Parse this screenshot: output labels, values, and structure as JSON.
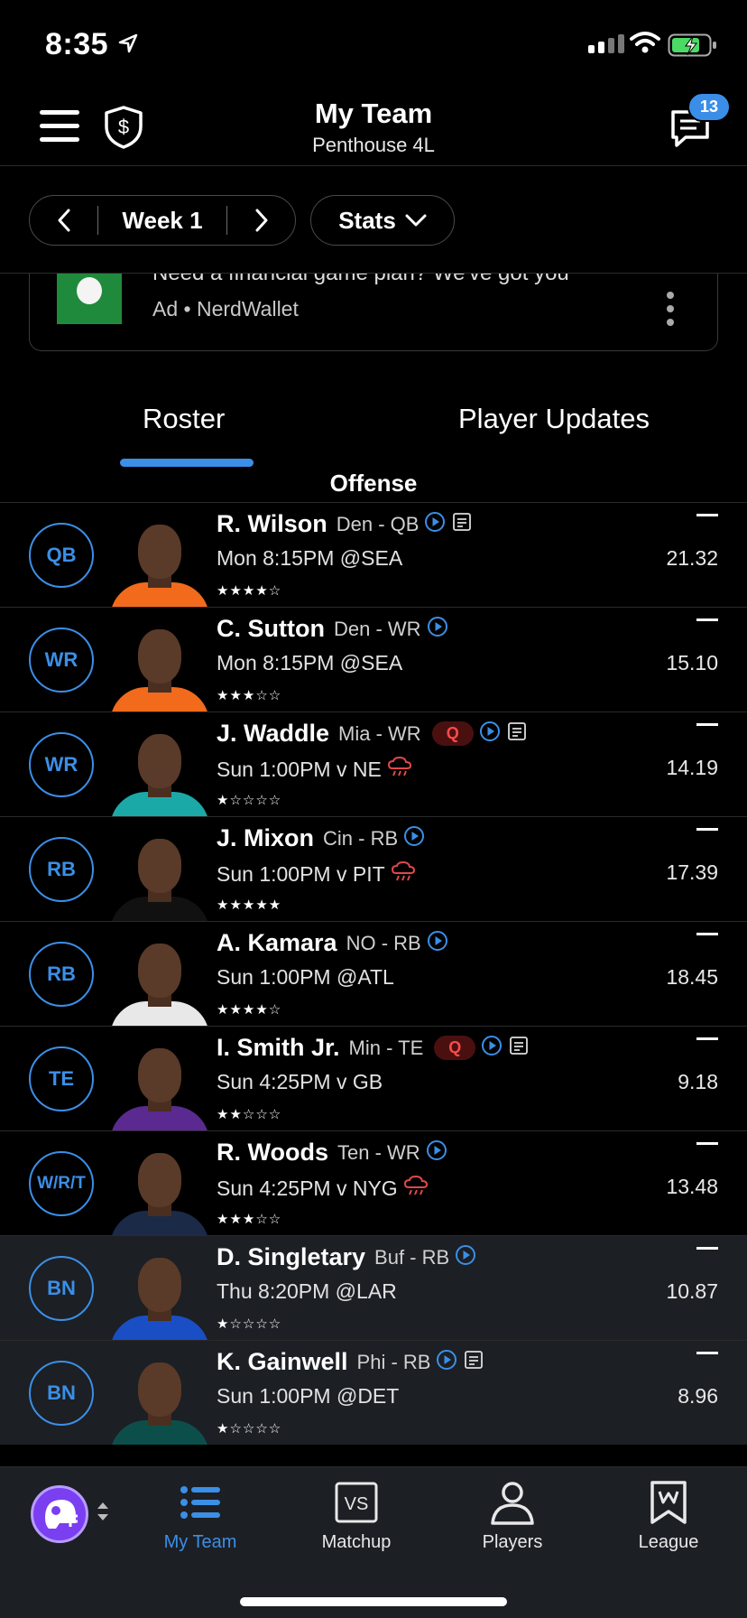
{
  "status_bar": {
    "time": "8:35"
  },
  "header": {
    "title": "My Team",
    "subtitle": "Penthouse 4L",
    "chat_badge": "13"
  },
  "controls": {
    "week_label": "Week 1",
    "stats_label": "Stats"
  },
  "ad": {
    "headline": "Need a financial game plan? We've got you",
    "sponsor": "Ad • NerdWallet"
  },
  "tabs": [
    {
      "label": "Roster",
      "active": true
    },
    {
      "label": "Player Updates",
      "active": false
    }
  ],
  "section": {
    "label": "Offense"
  },
  "roster": [
    {
      "pos": "QB",
      "name": "R. Wilson",
      "team_pos": "Den - QB",
      "status": "",
      "has_news": true,
      "game": "Mon 8:15PM @SEA",
      "weather": false,
      "rating": "★★★★☆",
      "score": "21.32",
      "jersey": "#f26a1b",
      "bench": false
    },
    {
      "pos": "WR",
      "name": "C. Sutton",
      "team_pos": "Den - WR",
      "status": "",
      "has_news": false,
      "game": "Mon 8:15PM @SEA",
      "weather": false,
      "rating": "★★★☆☆",
      "score": "15.10",
      "jersey": "#f26a1b",
      "bench": false
    },
    {
      "pos": "WR",
      "name": "J. Waddle",
      "team_pos": "Mia - WR",
      "status": "Q",
      "has_news": true,
      "game": "Sun 1:00PM v NE",
      "weather": true,
      "rating": "★☆☆☆☆",
      "score": "14.19",
      "jersey": "#1ba9a8",
      "bench": false
    },
    {
      "pos": "RB",
      "name": "J. Mixon",
      "team_pos": "Cin - RB",
      "status": "",
      "has_news": false,
      "game": "Sun 1:00PM v PIT",
      "weather": true,
      "rating": "★★★★★",
      "score": "17.39",
      "jersey": "#111111",
      "bench": false
    },
    {
      "pos": "RB",
      "name": "A. Kamara",
      "team_pos": "NO - RB",
      "status": "",
      "has_news": false,
      "game": "Sun 1:00PM @ATL",
      "weather": false,
      "rating": "★★★★☆",
      "score": "18.45",
      "jersey": "#e8e8e8",
      "bench": false
    },
    {
      "pos": "TE",
      "name": "I. Smith Jr.",
      "team_pos": "Min - TE",
      "status": "Q",
      "has_news": true,
      "game": "Sun 4:25PM v GB",
      "weather": false,
      "rating": "★★☆☆☆",
      "score": "9.18",
      "jersey": "#5b2a90",
      "bench": false
    },
    {
      "pos": "W/R/T",
      "name": "R. Woods",
      "team_pos": "Ten - WR",
      "status": "",
      "has_news": false,
      "game": "Sun 4:25PM v NYG",
      "weather": true,
      "rating": "★★★☆☆",
      "score": "13.48",
      "jersey": "#1b2a47",
      "bench": false
    },
    {
      "pos": "BN",
      "name": "D. Singletary",
      "team_pos": "Buf - RB",
      "status": "",
      "has_news": false,
      "game": "Thu 8:20PM @LAR",
      "weather": false,
      "rating": "★☆☆☆☆",
      "score": "10.87",
      "jersey": "#1a4ec4",
      "bench": true
    },
    {
      "pos": "BN",
      "name": "K. Gainwell",
      "team_pos": "Phi - RB",
      "status": "",
      "has_news": true,
      "game": "Sun 1:00PM @DET",
      "weather": false,
      "rating": "★☆☆☆☆",
      "score": "8.96",
      "jersey": "#0c4f4a",
      "bench": true
    }
  ],
  "bottom_nav": [
    {
      "label": "My Team",
      "icon": "list-icon",
      "active": true
    },
    {
      "label": "Matchup",
      "icon": "vs-icon",
      "active": false
    },
    {
      "label": "Players",
      "icon": "person-icon",
      "active": false
    },
    {
      "label": "League",
      "icon": "bookmark-icon",
      "active": false
    }
  ],
  "colors": {
    "accent": "#3b8fe6",
    "q_badge_text": "#ff4a4a",
    "bench_bg": "#1c1f24",
    "background": "#000000"
  }
}
